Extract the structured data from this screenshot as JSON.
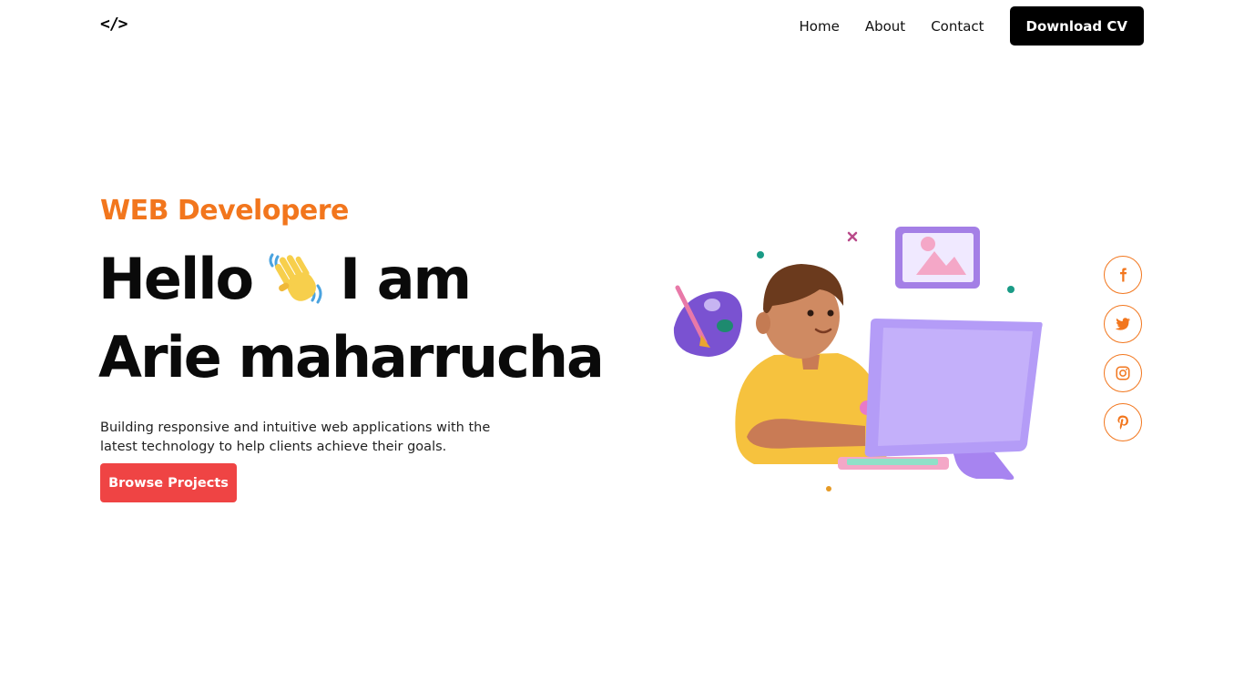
{
  "brand": {
    "logo_text": "</>"
  },
  "nav": {
    "links": [
      "Home",
      "About",
      "Contact"
    ],
    "cta_label": "Download CV"
  },
  "hero": {
    "role": "WEB Developere",
    "greeting_before": "Hello",
    "greeting_after": "I am",
    "name": "Arie maharrucha",
    "description": "Building responsive and intuitive web applications with the latest technology to help clients achieve their goals.",
    "button_label": "Browse Projects"
  },
  "social": {
    "icons": [
      "facebook-icon",
      "twitter-icon",
      "instagram-icon",
      "pinterest-icon"
    ]
  },
  "colors": {
    "accent": "#f2761d",
    "button_red": "#ef4444",
    "dark": "#000000"
  }
}
